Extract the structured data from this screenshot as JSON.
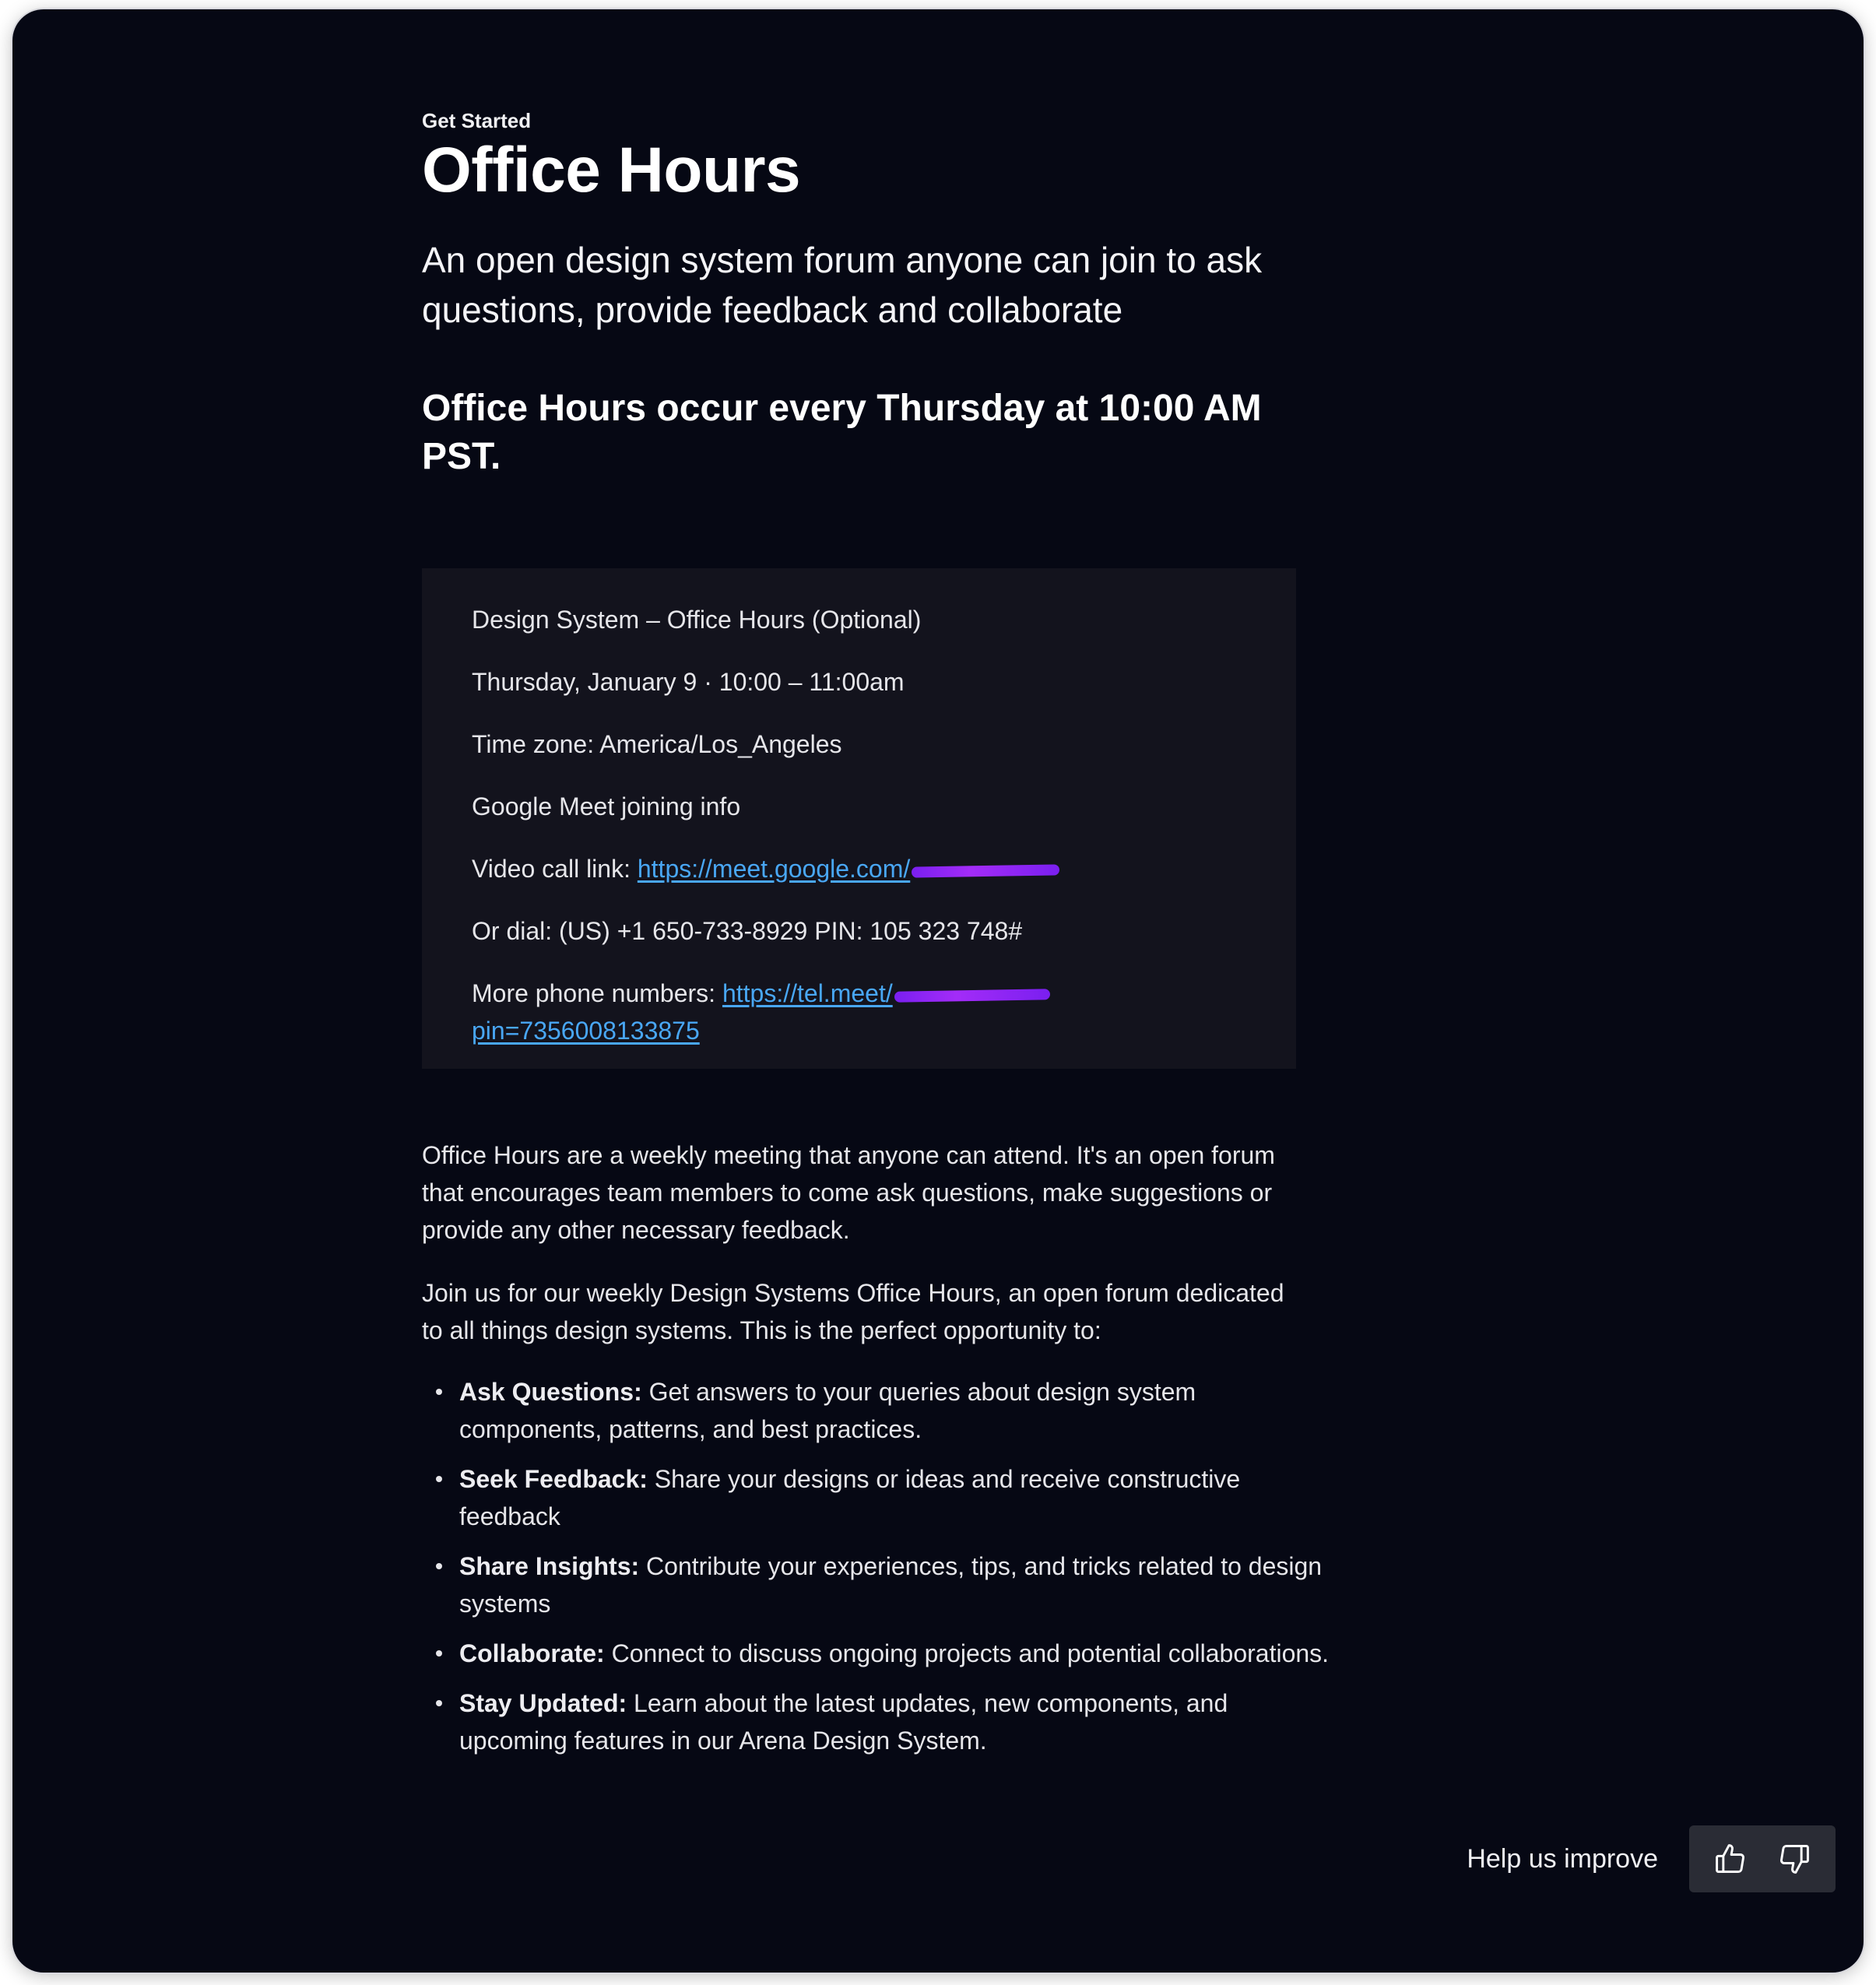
{
  "page": {
    "eyebrow": "Get Started",
    "title": "Office Hours",
    "subtitle": "An open design system forum anyone can join to ask questions, provide feedback and collaborate",
    "schedule": "Office Hours occur every Thursday at 10:00 AM PST."
  },
  "event": {
    "name": "Design System – Office Hours (Optional)",
    "datetime": "Thursday, January 9 · 10:00 – 11:00am",
    "timezone": "Time zone: America/Los_Angeles",
    "meet_heading": "Google Meet joining info",
    "video_label": "Video call link: ",
    "video_link": "https://meet.google.com/",
    "dial": "Or dial: (US) +1 650-733-8929 PIN: 105 323 748#",
    "more_label": "More phone numbers: ",
    "more_link": "https://tel.meet/",
    "more_link_pin": "pin=7356008133875"
  },
  "body": {
    "paragraph_1": "Office Hours are a weekly meeting that anyone can attend. It's an open forum that encourages team members to come ask questions, make suggestions or provide any other necessary feedback.",
    "paragraph_2": "Join us for our weekly Design Systems Office Hours, an open forum dedicated to all things design systems. This is the perfect opportunity to:",
    "bullets": [
      {
        "term": "Ask Questions:",
        "text": " Get answers to your queries about design system components, patterns, and best practices."
      },
      {
        "term": "Seek Feedback:",
        "text": " Share your designs or ideas and receive constructive feedback"
      },
      {
        "term": "Share Insights:",
        "text": " Contribute your experiences, tips, and tricks related to design systems"
      },
      {
        "term": "Collaborate:",
        "text": " Connect to discuss ongoing projects and potential collaborations."
      },
      {
        "term": "Stay Updated:",
        "text": " Learn about the latest updates, new components, and upcoming features in our Arena Design System."
      }
    ]
  },
  "feedback": {
    "label": "Help us improve",
    "icons": [
      "thumbs-up-icon",
      "thumbs-down-icon"
    ]
  },
  "colors": {
    "background": "#060814",
    "card": "#13131d",
    "link": "#49a7f5",
    "redaction": "#8a22f5",
    "feedback_bg": "#2a2c35"
  }
}
